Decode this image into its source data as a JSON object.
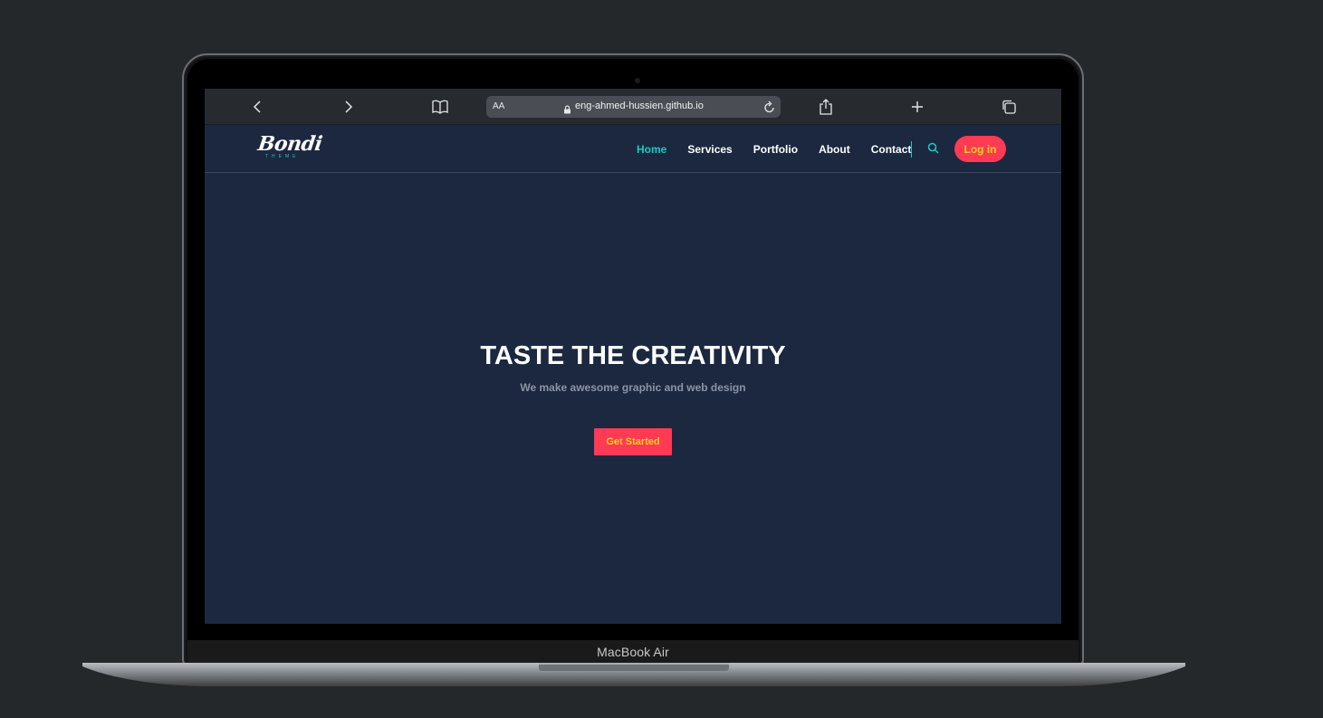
{
  "device": {
    "label": "MacBook Air"
  },
  "browser": {
    "address_bar": {
      "text_size_label": "AA",
      "url": "eng-ahmed-hussien.github.io"
    },
    "icons": {
      "back": "chevron-left-icon",
      "forward": "chevron-right-icon",
      "bookmarks": "book-icon",
      "lock": "lock-icon",
      "reload": "reload-icon",
      "share": "share-icon",
      "new_tab": "plus-icon",
      "tabs": "tabs-icon"
    }
  },
  "site": {
    "logo": {
      "name": "Bondi",
      "tagline": "THEME"
    },
    "nav": {
      "items": [
        {
          "label": "Home",
          "active": true
        },
        {
          "label": "Services",
          "active": false
        },
        {
          "label": "Portfolio",
          "active": false
        },
        {
          "label": "About",
          "active": false
        },
        {
          "label": "Contact",
          "active": false
        }
      ],
      "search_icon": "search-icon",
      "login_label": "Log in"
    },
    "hero": {
      "title": "TASTE THE CREATIVITY",
      "subtitle": "We make awesome graphic and web design",
      "cta_label": "Get Started"
    },
    "colors": {
      "background": "#1b2840",
      "accent": "#1ec9c4",
      "button": "#ff3a54",
      "button_text": "#ffd21f"
    }
  }
}
